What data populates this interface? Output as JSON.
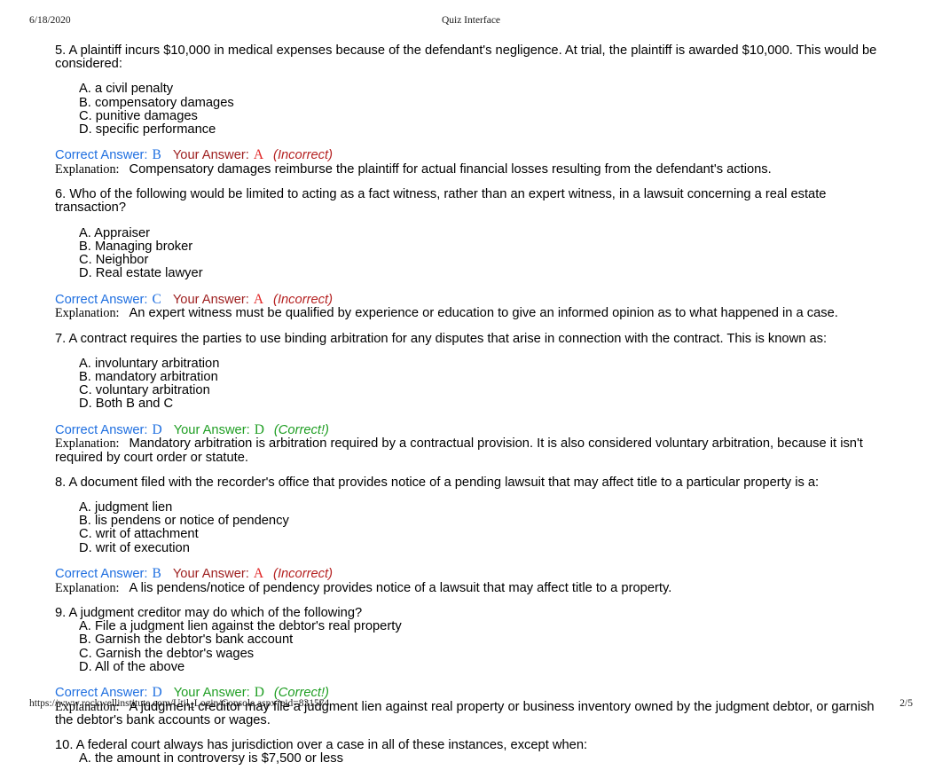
{
  "page": {
    "header": {
      "date": "6/18/2020",
      "title": "Quiz Interface"
    },
    "footer": {
      "url": "https://www.rockwellinstitute.com/Util_Login/Console.aspx?eid=831574",
      "page_number": "2/5"
    }
  },
  "labels": {
    "correct_answer": "Correct Answer:",
    "your_answer": "Your Answer:",
    "explanation": "Explanation:",
    "verdict_incorrect": "(Incorrect)",
    "verdict_correct": "(Correct!)"
  },
  "colors": {
    "correct_answer_blue": "#1f6fe0",
    "your_answer_red_label": "#9e2020",
    "your_answer_red_letter": "#e02020",
    "verdict_red": "#b52222",
    "green": "#1f9e23",
    "body_text": "#000000"
  },
  "questions": [
    {
      "number": "5",
      "stem": "5. A plaintiff incurs $10,000 in medical expenses because of the defendant's negligence. At trial, the plaintiff is awarded $10,000. This would be considered:",
      "options_gap": true,
      "options": [
        "A. a civil penalty",
        "B. compensatory damages",
        "C. punitive damages",
        "D. specific performance"
      ],
      "correct_answer": "B",
      "your_answer": "A",
      "result": "incorrect",
      "verdict": "(Incorrect)",
      "explanation": "Compensatory damages reimburse the plaintiff for actual financial losses resulting from the defendant's actions."
    },
    {
      "number": "6",
      "stem": "6. Who of the following would be limited to acting as a fact witness, rather than an expert witness, in a lawsuit concerning a real estate transaction?",
      "options_gap": true,
      "options": [
        "A. Appraiser",
        "B. Managing broker",
        "C. Neighbor",
        "D. Real estate lawyer"
      ],
      "correct_answer": "C",
      "your_answer": "A",
      "result": "incorrect",
      "verdict": "(Incorrect)",
      "explanation": "An expert witness must be qualified by experience or education to give an informed opinion as to what happened in a case."
    },
    {
      "number": "7",
      "stem": "7. A contract requires the parties to use binding arbitration for any disputes that arise in connection with the contract. This is known as:",
      "options_gap": true,
      "options": [
        "A. involuntary arbitration",
        "B. mandatory arbitration",
        "C. voluntary arbitration",
        "D. Both B and C"
      ],
      "correct_answer": "D",
      "your_answer": "D",
      "result": "correct",
      "verdict": "(Correct!)",
      "explanation": "Mandatory arbitration is arbitration required by a contractual provision. It is also considered voluntary arbitration, because it isn't required by court order or statute."
    },
    {
      "number": "8",
      "stem": "8. A document filed with the recorder's office that provides notice of a pending lawsuit that may affect title to a particular property is a:",
      "options_gap": true,
      "options": [
        "A. judgment lien",
        "B. lis pendens or notice of pendency",
        "C. writ of attachment",
        "D. writ of execution"
      ],
      "correct_answer": "B",
      "your_answer": "A",
      "result": "incorrect",
      "verdict": "(Incorrect)",
      "explanation": "A lis pendens/notice of pendency provides notice of a lawsuit that may affect title to a property."
    },
    {
      "number": "9",
      "stem": "9. A judgment creditor may do which of the following?",
      "options_gap": false,
      "options": [
        "A. File a judgment lien against the debtor's real property",
        "B. Garnish the debtor's bank account",
        "C. Garnish the debtor's wages",
        "D. All of the above"
      ],
      "correct_answer": "D",
      "your_answer": "D",
      "result": "correct",
      "verdict": "(Correct!)",
      "explanation": "A judgment creditor may file a judgment lien against real property or business inventory owned by the judgment debtor, or garnish the debtor's bank accounts or wages."
    },
    {
      "number": "10",
      "stem": "10. A federal court always has jurisdiction over a case in all of these instances, except when:",
      "options_gap": false,
      "options": [
        "A. the amount in controversy is $7,500 or less"
      ],
      "correct_answer": null,
      "your_answer": null,
      "result": null,
      "verdict": null,
      "explanation": null
    }
  ]
}
